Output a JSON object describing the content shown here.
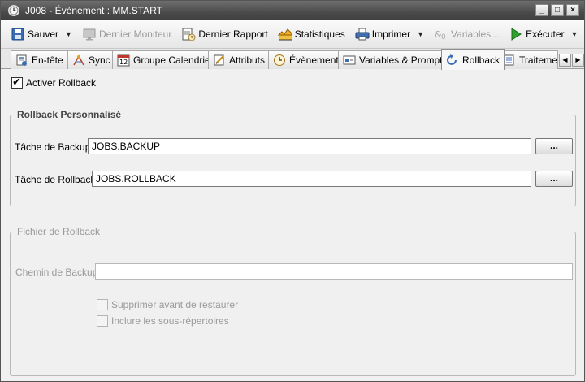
{
  "window": {
    "title": "J008 - Évènement : MM.START",
    "buttons": [
      "_",
      "□",
      "×"
    ]
  },
  "toolbar": {
    "save": "Sauver",
    "last_monitor": "Dernier Moniteur",
    "last_report": "Dernier Rapport",
    "statistics": "Statistiques",
    "print": "Imprimer",
    "variables": "Variables...",
    "execute": "Exécuter"
  },
  "tabs": [
    {
      "label": "En-tête",
      "icon": "header-icon"
    },
    {
      "label": "Sync",
      "icon": "sync-icon"
    },
    {
      "label": "Groupe Calendrier",
      "icon": "calendar-icon"
    },
    {
      "label": "Attributs",
      "icon": "attributes-icon"
    },
    {
      "label": "Évènement",
      "icon": "event-clock-icon"
    },
    {
      "label": "Variables & Prompts",
      "icon": "variables-icon"
    },
    {
      "label": "Rollback",
      "icon": "rollback-icon",
      "active": true
    },
    {
      "label": "Traitemen",
      "icon": "process-icon"
    }
  ],
  "rollback": {
    "enable_label": "Activer Rollback",
    "enabled": true,
    "custom_group": {
      "title": "Rollback Personnalisé",
      "backup_label": "Tâche de Backup:",
      "backup_value": "JOBS.BACKUP",
      "rollback_label": "Tâche de Rollback:",
      "rollback_value": "JOBS.ROLLBACK",
      "browse_label": "..."
    },
    "file_group": {
      "title": "Fichier de Rollback",
      "path_label": "Chemin de Backup:",
      "path_value": "",
      "delete_before_label": "Supprimer avant de restaurer",
      "include_sub_label": "Inclure les sous-répertoires"
    }
  }
}
